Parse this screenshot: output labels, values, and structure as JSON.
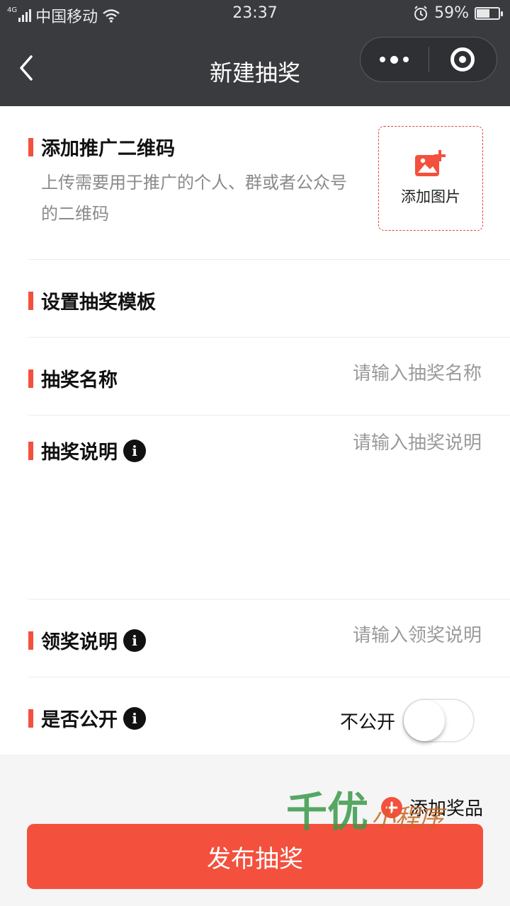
{
  "status_bar": {
    "network_type": "4G",
    "carrier": "中国移动",
    "time": "23:37",
    "battery_percent": "59%",
    "battery_level": 0.59
  },
  "nav": {
    "title": "新建抽奖",
    "back_icon": "chevron-left-icon",
    "more_icon": "more-dots-icon",
    "close_icon": "target-circle-icon"
  },
  "qrcode_section": {
    "title": "添加推广二维码",
    "description": "上传需要用于推广的个人、群或者公众号的二维码",
    "add_image_label": "添加图片",
    "add_image_icon": "image-plus-icon"
  },
  "template_section": {
    "title": "设置抽奖模板"
  },
  "name_field": {
    "label": "抽奖名称",
    "placeholder": "请输入抽奖名称",
    "value": ""
  },
  "description_field": {
    "label": "抽奖说明",
    "placeholder": "请输入抽奖说明",
    "value": ""
  },
  "claim_field": {
    "label": "领奖说明",
    "placeholder": "请输入领奖说明",
    "value": ""
  },
  "public_field": {
    "label": "是否公开",
    "state_label": "不公开",
    "enabled": false
  },
  "bottom": {
    "add_prize_label": "添加奖品",
    "publish_label": "发布抽奖"
  },
  "watermark": {
    "text_main": "千优",
    "text_sub": "小程序"
  },
  "colors": {
    "accent": "#f4503e",
    "header_bg": "#3a3b3f",
    "placeholder": "#9a9a9a"
  }
}
